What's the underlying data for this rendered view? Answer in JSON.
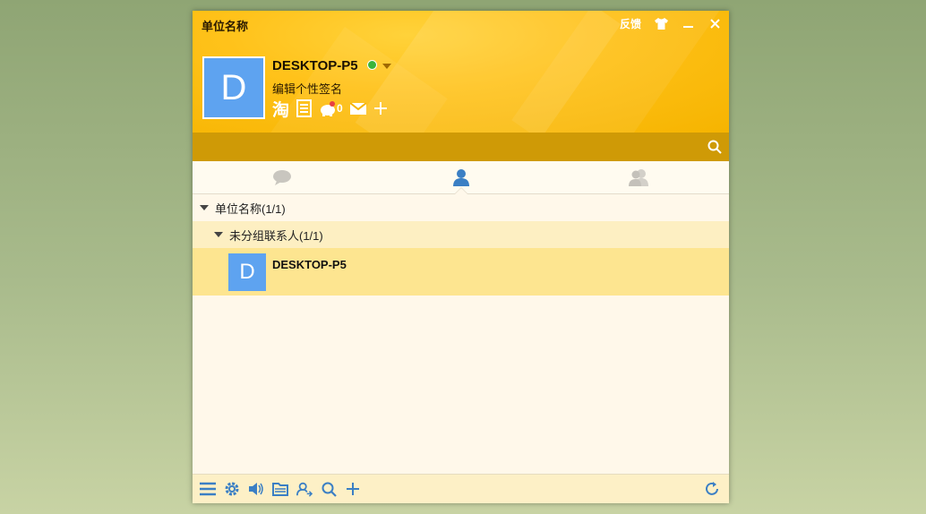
{
  "window": {
    "title": "单位名称",
    "feedback_label": "反馈"
  },
  "profile": {
    "avatar_letter": "D",
    "name": "DESKTOP-P5",
    "signature": "编辑个性签名",
    "tools": {
      "taobao_label": "淘",
      "pet_count": "0"
    }
  },
  "search": {
    "placeholder": ""
  },
  "tabs": [
    {
      "name": "tab-messages",
      "icon": "chat-bubble-icon"
    },
    {
      "name": "tab-contacts",
      "icon": "person-icon",
      "active": true
    },
    {
      "name": "tab-groups",
      "icon": "group-icon"
    }
  ],
  "contacts": {
    "group_label": "单位名称(1/1)",
    "subgroup_label": "未分组联系人(1/1)",
    "items": [
      {
        "avatar_letter": "D",
        "name": "DESKTOP-P5"
      }
    ]
  },
  "colors": {
    "accent": "#ffc21a",
    "search_bar": "#cf9a06",
    "icon_blue": "#3b7fc4",
    "avatar": "#5ea3f0"
  }
}
